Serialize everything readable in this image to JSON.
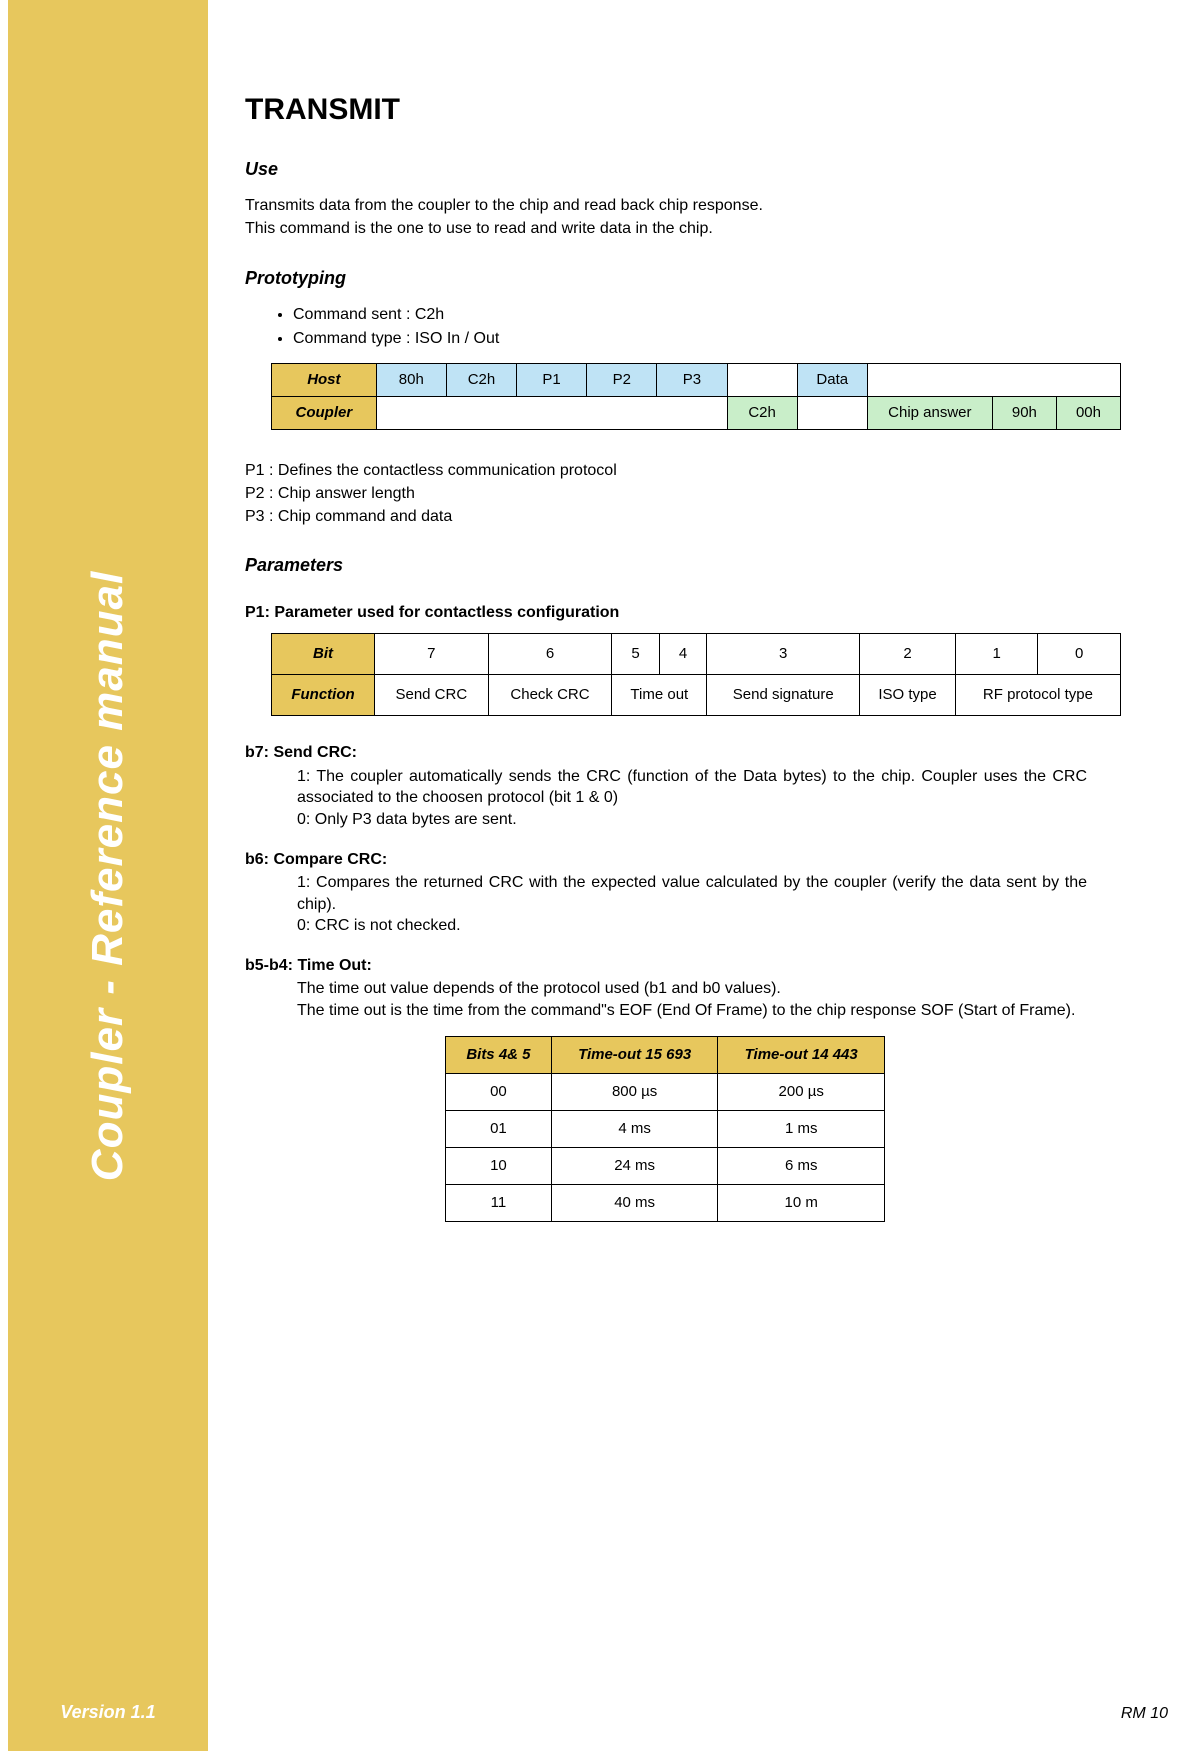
{
  "sidebar": {
    "title": "Coupler - Reference manual",
    "version": "Version 1.1"
  },
  "footer": {
    "right": "RM 10"
  },
  "title": "TRANSMIT",
  "use": {
    "heading": "Use",
    "line1": "Transmits data from the coupler to the chip and read back chip response.",
    "line2": "This command is the one to use to read and write data in the chip."
  },
  "prototyping": {
    "heading": "Prototyping",
    "bullet1": "Command sent : C2h",
    "bullet2": "Command type : ISO In / Out",
    "row1": {
      "label": "Host",
      "c1": "80h",
      "c2": "C2h",
      "c3": "P1",
      "c4": "P2",
      "c5": "P3",
      "c6": "",
      "c7": "Data",
      "c8": "",
      "c9": "",
      "c10": ""
    },
    "row2": {
      "label": "Coupler",
      "c6": "C2h",
      "c8": "Chip answer",
      "c9": "90h",
      "c10": "00h"
    },
    "def1": "P1 : Defines the contactless communication protocol",
    "def2": "P2 : Chip answer length",
    "def3": "P3 : Chip command and data"
  },
  "parameters": {
    "heading": "Parameters",
    "sub1": "P1: Parameter used for contactless configuration",
    "bit_row_label": "Bit",
    "bits": [
      "7",
      "6",
      "5",
      "4",
      "3",
      "2",
      "1",
      "0"
    ],
    "func_row_label": "Function",
    "funcs": {
      "f7": "Send CRC",
      "f6": "Check CRC",
      "f54": "Time out",
      "f3": "Send signature",
      "f2": "ISO type",
      "f10": "RF protocol type"
    }
  },
  "b7": {
    "title": "b7: Send CRC:",
    "l1": "1: The coupler automatically sends the CRC (function of the Data bytes) to the chip. Coupler uses the CRC associated to the choosen protocol (bit 1 & 0)",
    "l2": "0: Only P3 data bytes are sent."
  },
  "b6": {
    "title": "b6: Compare CRC:",
    "l1": "1: Compares the returned CRC with the expected value calculated by the coupler (verify the data sent by the chip).",
    "l2": "0: CRC is not checked."
  },
  "b5b4": {
    "title": "b5-b4: Time Out:",
    "l1": "The time out value depends of the protocol used (b1 and b0 values).",
    "l2": "The time out is the time from the command\"s EOF (End Of Frame) to the chip response SOF (Start of Frame)."
  },
  "timeout_table": {
    "h1": "Bits 4& 5",
    "h2": "Time-out 15 693",
    "h3": "Time-out 14 443",
    "rows": [
      [
        "00",
        "800 µs",
        "200 µs"
      ],
      [
        "01",
        "4 ms",
        "1 ms"
      ],
      [
        "10",
        "24 ms",
        "6 ms"
      ],
      [
        "11",
        "40 ms",
        "10 m"
      ]
    ]
  }
}
